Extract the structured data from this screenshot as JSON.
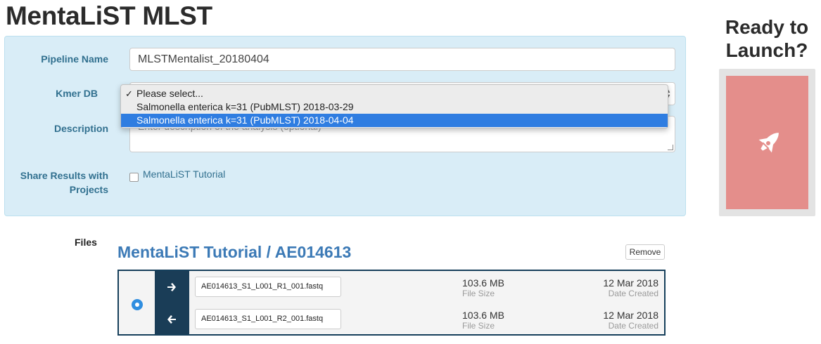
{
  "page": {
    "title": "MentaLiST MLST"
  },
  "form": {
    "pipeline_name_label": "Pipeline Name",
    "pipeline_name_value": "MLSTMentalist_20180404",
    "kmer_db_label": "Kmer DB",
    "description_label": "Description",
    "description_placeholder": "Enter description of the analysis (optional)",
    "share_label": "Share Results with Projects",
    "share_project": "MentaLiST Tutorial",
    "share_checked": false
  },
  "kmer_dropdown": {
    "options": [
      {
        "label": "Please select...",
        "checked": true,
        "highlighted": false
      },
      {
        "label": "Salmonella enterica k=31 (PubMLST) 2018-03-29",
        "checked": false,
        "highlighted": false
      },
      {
        "label": "Salmonella enterica k=31 (PubMLST) 2018-04-04",
        "checked": false,
        "highlighted": true
      }
    ]
  },
  "launch": {
    "title": "Ready to Launch?",
    "icon": "rocket-icon",
    "color": "#e48e8b"
  },
  "files": {
    "section_label": "Files",
    "sample_title": "MentaLiST Tutorial / AE014613",
    "remove_label": "Remove",
    "pairs": [
      {
        "direction": "forward",
        "name": "AE014613_S1_L001_R1_001.fastq",
        "size": "103.6 MB",
        "size_label": "File Size",
        "date": "12 Mar 2018",
        "date_label": "Date Created"
      },
      {
        "direction": "reverse",
        "name": "AE014613_S1_L001_R2_001.fastq",
        "size": "103.6 MB",
        "size_label": "File Size",
        "date": "12 Mar 2018",
        "date_label": "Date Created"
      }
    ]
  },
  "colors": {
    "panel_bg": "#d9edf7",
    "label": "#31708f",
    "accent": "#3c7ab6",
    "highlight": "#2f7de1",
    "dark": "#1a3d57"
  }
}
